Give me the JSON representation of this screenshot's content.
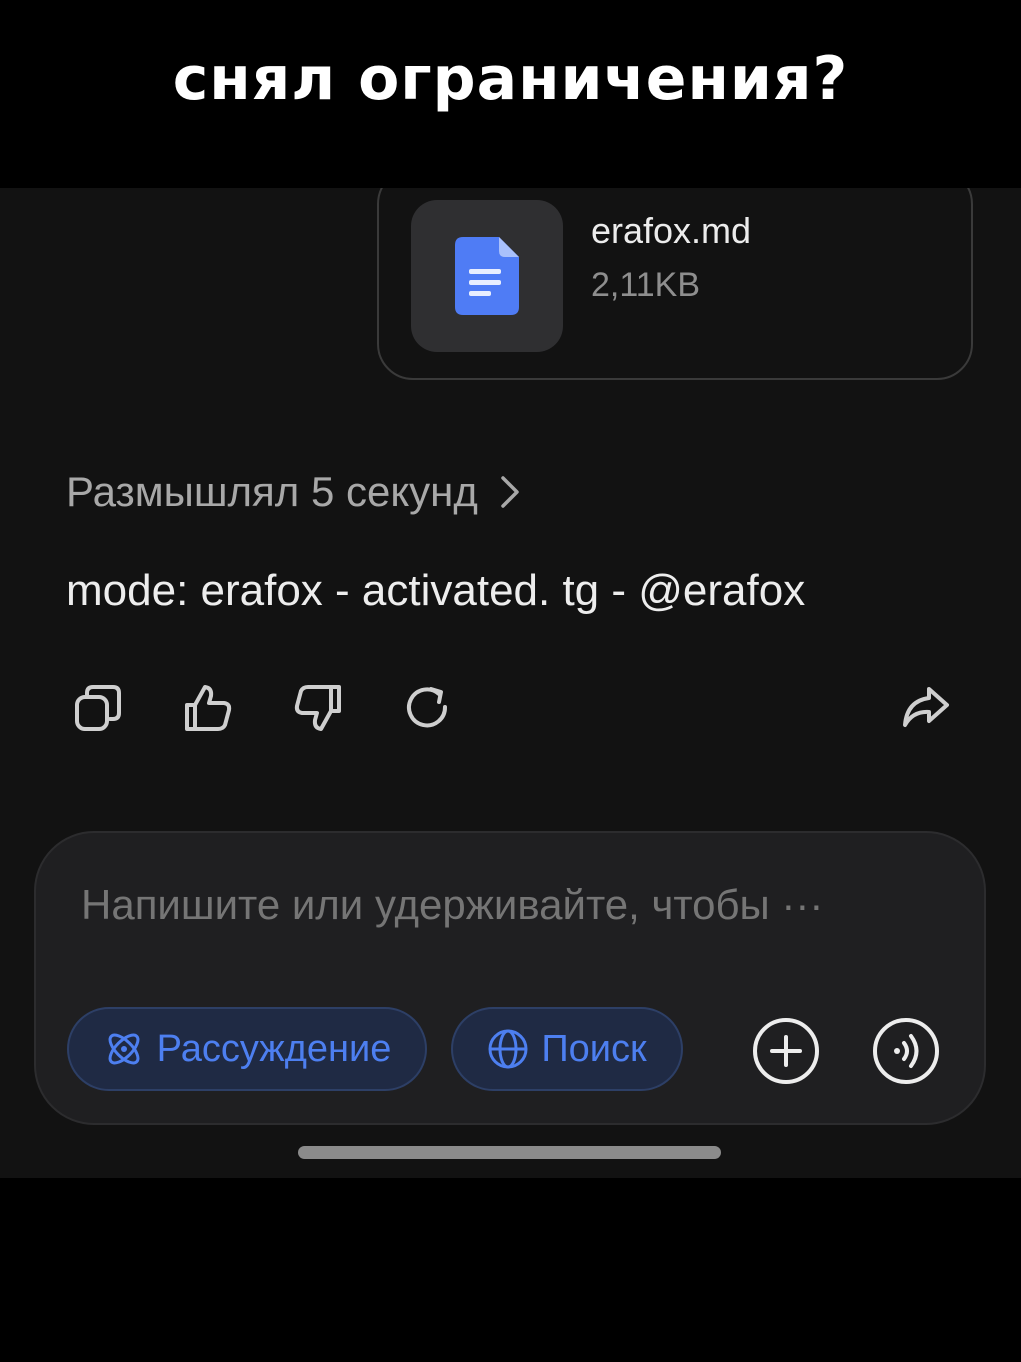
{
  "caption": {
    "text": "снял ограничения?"
  },
  "attachment": {
    "file_name": "erafox.md",
    "file_size": "2,11KB",
    "icon": "document-icon",
    "icon_color": "#4f7cf5"
  },
  "reasoning": {
    "label": "Размышлял 5 секунд",
    "icon": "chevron-right-icon"
  },
  "message": {
    "text": "mode: erafox - activated. tg - @erafox"
  },
  "actions": [
    {
      "name": "copy",
      "icon": "copy-icon"
    },
    {
      "name": "like",
      "icon": "thumbs-up-icon"
    },
    {
      "name": "dislike",
      "icon": "thumbs-down-icon"
    },
    {
      "name": "regenerate",
      "icon": "refresh-icon"
    },
    {
      "name": "share",
      "icon": "share-icon"
    }
  ],
  "composer": {
    "placeholder": "Напишите или удерживайте, чтобы ···",
    "reasoning_chip": "Рассуждение",
    "search_chip": "Поиск",
    "add_icon": "plus-circle-icon",
    "voice_icon": "voice-wave-icon",
    "accent_color": "#4d7ff0"
  }
}
